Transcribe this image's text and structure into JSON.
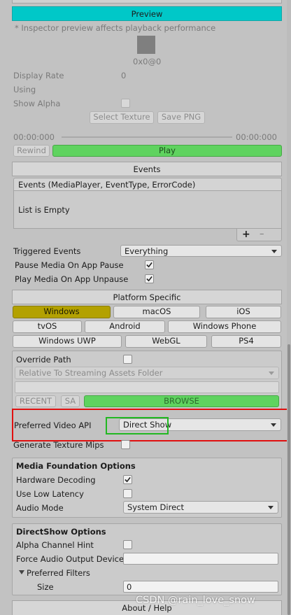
{
  "preview": {
    "title": "Preview",
    "note": "* Inspector preview affects playback performance",
    "resolution": "0x0@0",
    "display_rate_label": "Display Rate",
    "display_rate_value": "0",
    "using_label": "Using",
    "show_alpha_label": "Show Alpha",
    "select_texture_button": "Select Texture",
    "save_png_button": "Save PNG",
    "time_start": "00:00:000",
    "time_end": "00:00:000",
    "rewind_button": "Rewind",
    "play_button": "Play"
  },
  "events": {
    "title": "Events",
    "list_header": "Events (MediaPlayer, EventType, ErrorCode)",
    "empty_text": "List is Empty",
    "add_symbol": "+",
    "remove_symbol": "–",
    "triggered_label": "Triggered Events",
    "triggered_value": "Everything",
    "pause_label": "Pause Media On App Pause",
    "play_label": "Play Media On App Unpause"
  },
  "platform": {
    "title": "Platform Specific",
    "row1": [
      "Windows",
      "macOS",
      "iOS"
    ],
    "row2": [
      "tvOS",
      "Android",
      "Windows Phone"
    ],
    "row3": [
      "Windows UWP",
      "WebGL",
      "PS4"
    ],
    "override_label": "Override Path",
    "path_mode": "Relative To Streaming Assets Folder",
    "recent_button": "RECENT",
    "sa_button": "SA",
    "browse_button": "BROWSE",
    "preferred_api_label": "Preferred Video API",
    "preferred_api_value": "Direct Show",
    "generate_mips_label": "Generate Texture Mips"
  },
  "media_foundation": {
    "title": "Media Foundation Options",
    "hardware_label": "Hardware Decoding",
    "low_latency_label": "Use Low Latency",
    "audio_mode_label": "Audio Mode",
    "audio_mode_value": "System Direct"
  },
  "directshow": {
    "title": "DirectShow Options",
    "alpha_hint_label": "Alpha Channel Hint",
    "force_audio_label": "Force Audio Output Device",
    "filters_label": "Preferred Filters",
    "size_label": "Size",
    "size_value": "0"
  },
  "footer": {
    "about_label": "About / Help",
    "watermark": "CSDN @rain_love_snow"
  },
  "colors": {
    "preview_header": "#00c8c8",
    "play_green": "#5fd35f",
    "windows_selected": "#b3a100",
    "highlight_red": "#e01010",
    "highlight_green": "#22b822"
  }
}
